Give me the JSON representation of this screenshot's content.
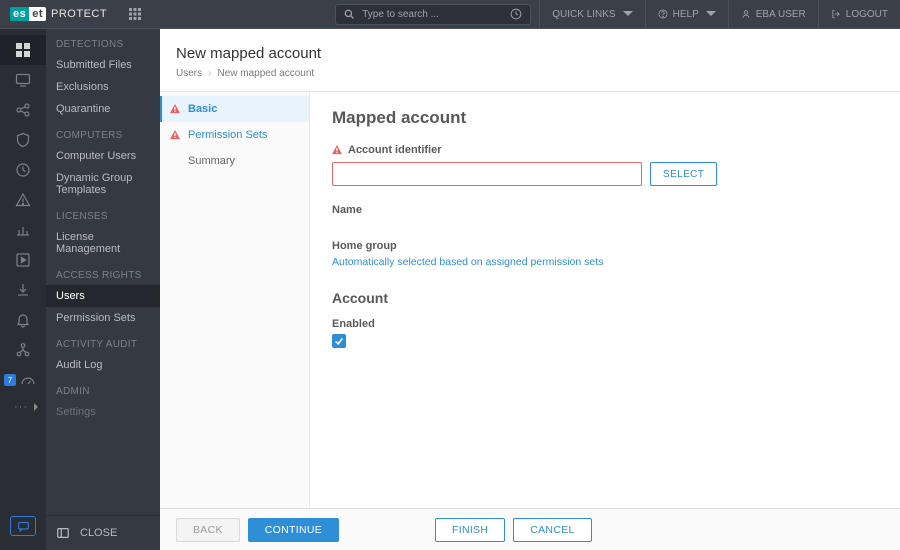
{
  "header": {
    "brand": "PROTECT",
    "search_placeholder": "Type to search ...",
    "quick_links": "QUICK LINKS",
    "help": "HELP",
    "user": "EBA USER",
    "logout": "LOGOUT"
  },
  "rail": {
    "badge": "7"
  },
  "sidebar": {
    "groups": [
      {
        "title": "DETECTIONS",
        "items": [
          "Submitted Files",
          "Exclusions",
          "Quarantine"
        ]
      },
      {
        "title": "COMPUTERS",
        "items": [
          "Computer Users",
          "Dynamic Group Templates"
        ]
      },
      {
        "title": "LICENSES",
        "items": [
          "License Management"
        ]
      },
      {
        "title": "ACCESS RIGHTS",
        "items": [
          "Users",
          "Permission Sets"
        ],
        "active": "Users"
      },
      {
        "title": "ACTIVITY AUDIT",
        "items": [
          "Audit Log"
        ]
      },
      {
        "title": "ADMIN",
        "items": [
          "Settings"
        ],
        "dim": true
      }
    ],
    "close": "CLOSE"
  },
  "page": {
    "title": "New mapped account",
    "crumb_parent": "Users",
    "crumb_current": "New mapped account"
  },
  "steps": {
    "basic": "Basic",
    "permission": "Permission Sets",
    "summary": "Summary"
  },
  "form": {
    "section1": "Mapped account",
    "account_identifier": "Account identifier",
    "select": "SELECT",
    "name": "Name",
    "home_group": "Home group",
    "home_group_hint": "Automatically selected based on assigned permission sets",
    "section2": "Account",
    "enabled": "Enabled"
  },
  "footer": {
    "back": "BACK",
    "continue": "CONTINUE",
    "finish": "FINISH",
    "cancel": "CANCEL"
  }
}
